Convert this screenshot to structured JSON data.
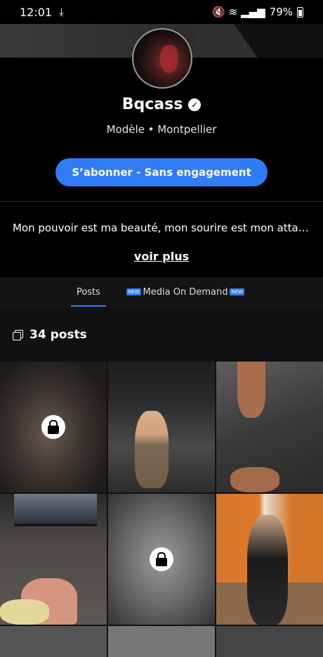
{
  "status_bar": {
    "time": "12:01",
    "download_glyph": "⤓",
    "signal_glyphs": "🔇 ≋ ▂▄▆",
    "battery": "79%"
  },
  "profile": {
    "name": "Bqcass",
    "verified_glyph": "✓",
    "subtitle": "Modèle • Montpellier",
    "subscribe_label": "S’abonner - Sans engagement",
    "bio": "Mon pouvoir est ma beauté, mon sourire est mon attaqu…",
    "see_more": "voir plus"
  },
  "tabs": {
    "posts": "Posts",
    "new_badge": "NEW",
    "media": "Media On Demand"
  },
  "feed": {
    "count_label": "34 posts"
  },
  "colors": {
    "accent": "#2f7cf6",
    "background": "#000000"
  }
}
